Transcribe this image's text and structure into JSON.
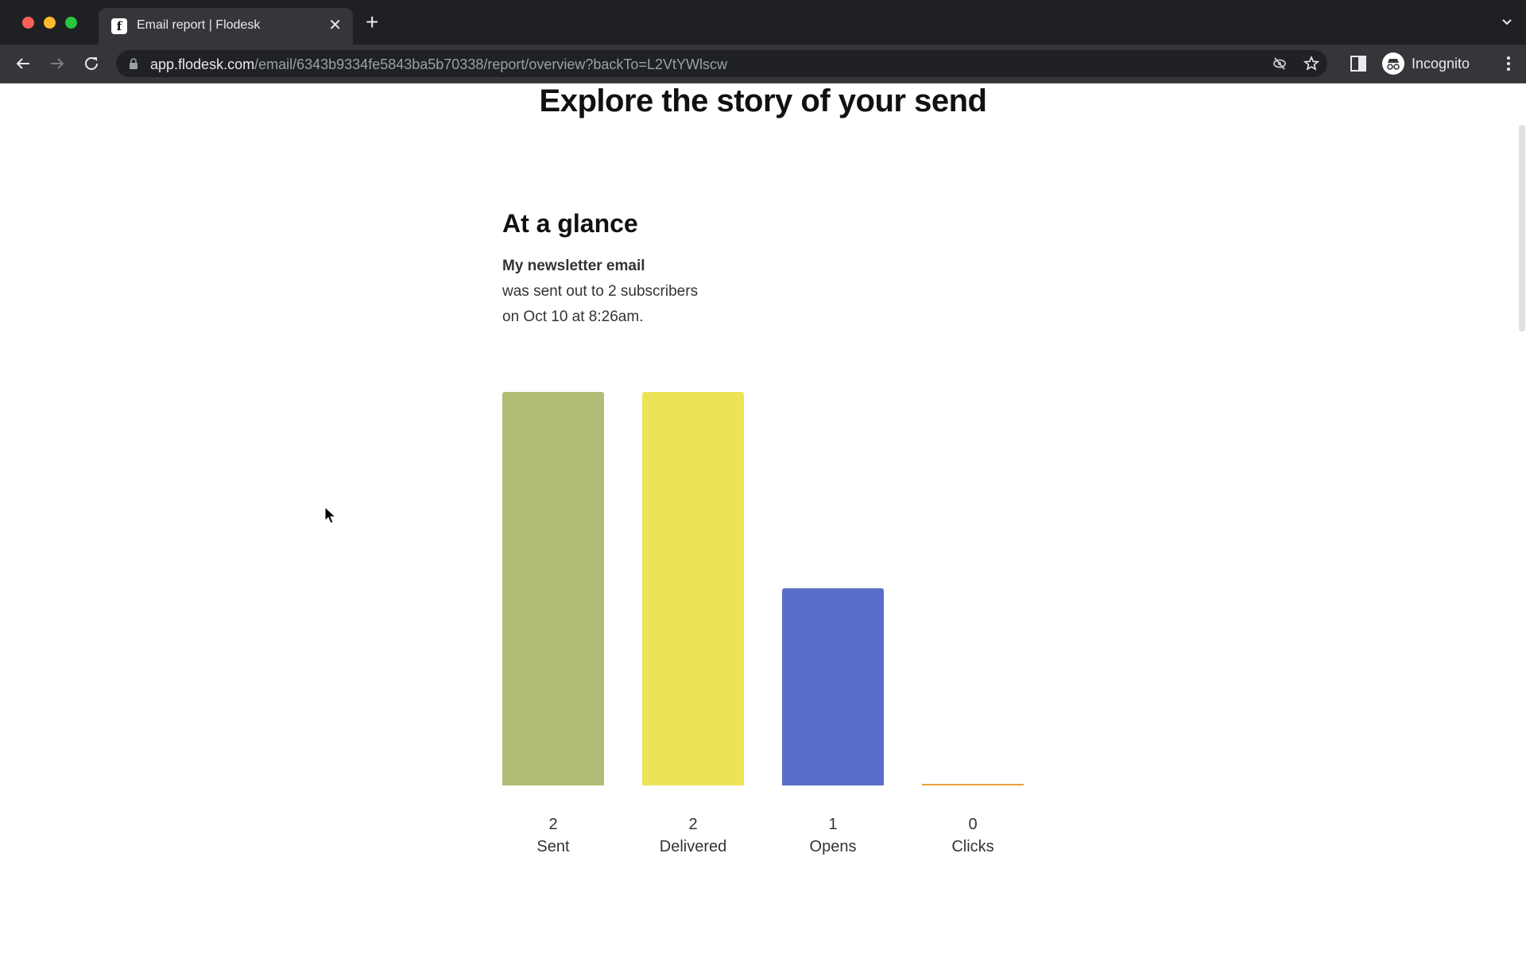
{
  "browser": {
    "tab_title": "Email report | Flodesk",
    "tab_favicon": "f",
    "url_host": "app.flodesk.com",
    "url_path": "/email/6343b9334fe5843ba5b70338/report/overview?backTo=L2VtYWlscw",
    "profile_label": "Incognito"
  },
  "page": {
    "heading": "Explore the story of your send",
    "section_title": "At a glance",
    "email_name": "My newsletter email",
    "desc_line2": "was sent out to 2 subscribers",
    "desc_line3": "on Oct 10 at 8:26am."
  },
  "chart_data": {
    "type": "bar",
    "title": "",
    "xlabel": "",
    "ylabel": "",
    "categories": [
      "Sent",
      "Delivered",
      "Opens",
      "Clicks"
    ],
    "values": [
      2,
      2,
      1,
      0
    ],
    "value_labels": [
      "2",
      "2",
      "1",
      "0"
    ],
    "colors": [
      "#b0bd75",
      "#ede358",
      "#5a6ec9",
      "#e8a33c"
    ],
    "ylim": [
      0,
      2
    ],
    "grid": false,
    "legend": "none"
  }
}
